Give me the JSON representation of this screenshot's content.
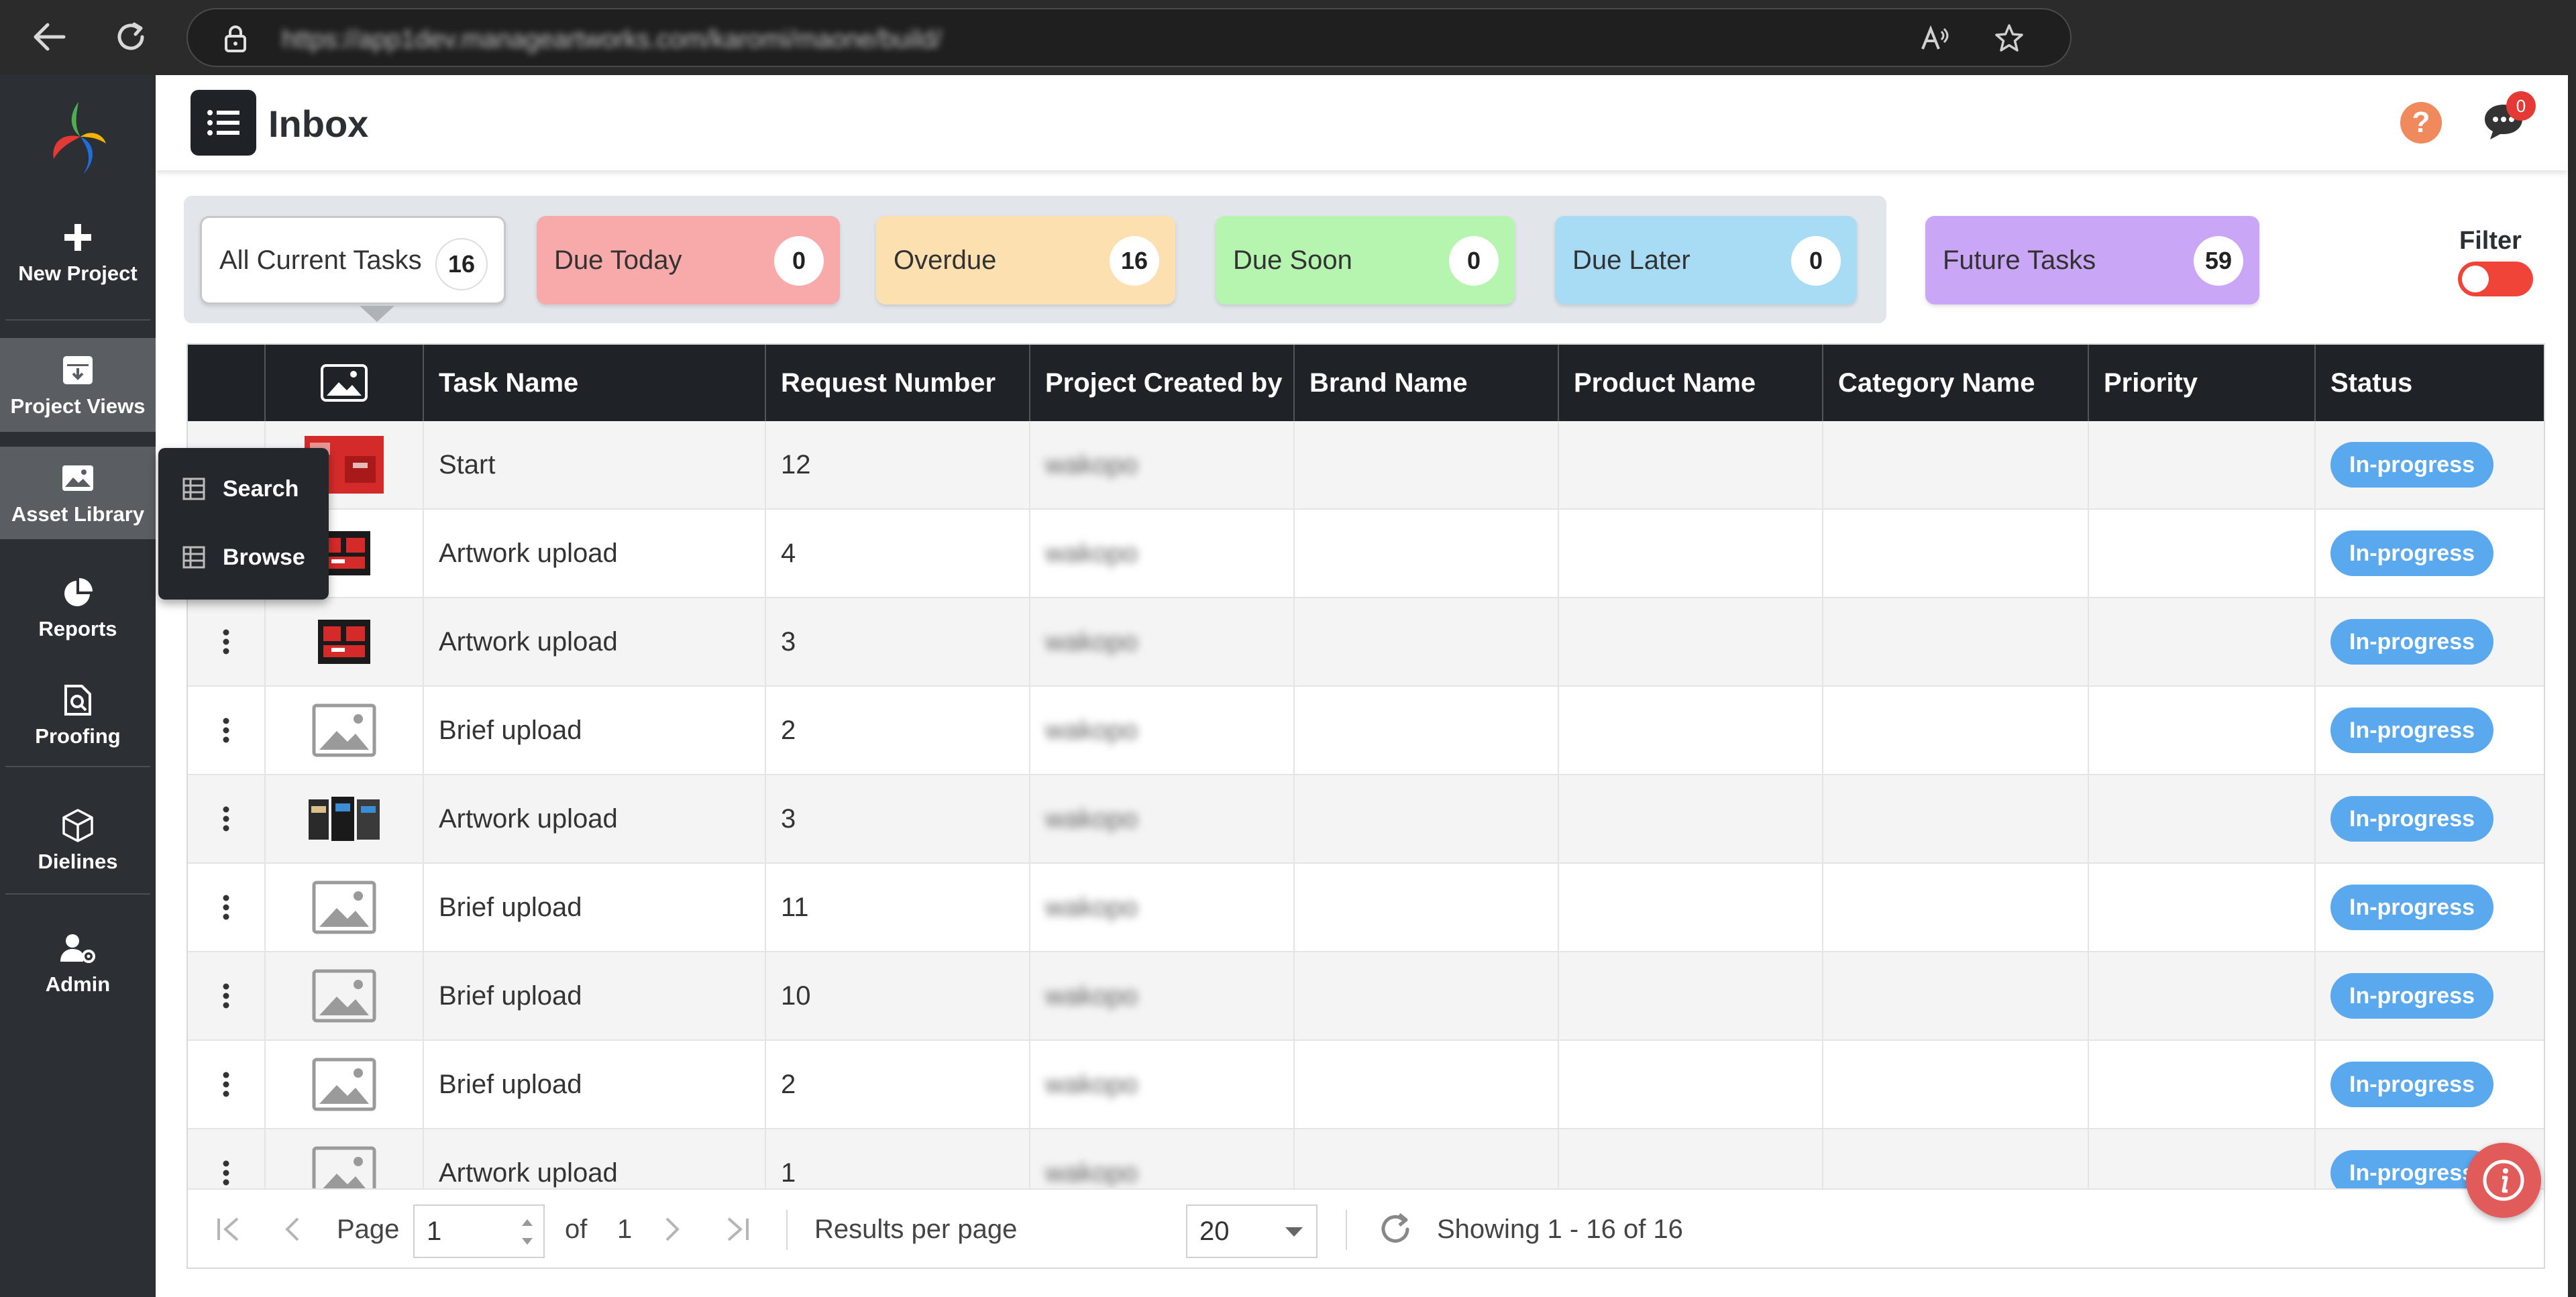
{
  "browser": {
    "url": "https://app1dev.manageartworks.com/karomi/maone/build/"
  },
  "sidebar": {
    "items": [
      {
        "label": "New Project",
        "icon": "plus-icon"
      },
      {
        "label": "Project Views",
        "icon": "archive-box-icon"
      },
      {
        "label": "Asset Library",
        "icon": "image-icon"
      },
      {
        "label": "Reports",
        "icon": "pie-chart-icon"
      },
      {
        "label": "Proofing",
        "icon": "document-search-icon"
      },
      {
        "label": "Dielines",
        "icon": "cube-icon"
      },
      {
        "label": "Admin",
        "icon": "user-gear-icon"
      }
    ]
  },
  "flyout": {
    "items": [
      {
        "label": "Search",
        "icon": "table-icon"
      },
      {
        "label": "Browse",
        "icon": "table-icon"
      }
    ]
  },
  "header": {
    "title": "Inbox",
    "help_symbol": "?",
    "chat_badge": "0"
  },
  "tabs": [
    {
      "label": "All Current Tasks",
      "count": "16",
      "color": "#ffffff"
    },
    {
      "label": "Due Today",
      "count": "0",
      "color": "#f8a9a9"
    },
    {
      "label": "Overdue",
      "count": "16",
      "color": "#fde0b0"
    },
    {
      "label": "Due Soon",
      "count": "0",
      "color": "#b6f5b0"
    },
    {
      "label": "Due Later",
      "count": "0",
      "color": "#a8dcf5"
    }
  ],
  "future_tab": {
    "label": "Future Tasks",
    "count": "59",
    "color": "#c9a6f6"
  },
  "filter": {
    "label": "Filter",
    "enabled": false
  },
  "table": {
    "columns": [
      "Task Name",
      "Request Number",
      "Project Created by",
      "Brand Name",
      "Product Name",
      "Category Name",
      "Priority",
      "Status"
    ],
    "rows": [
      {
        "thumb": "red-artwork",
        "task": "Start",
        "request": "12",
        "creator": "wakopo",
        "brand": "",
        "product": "",
        "category": "",
        "priority": "",
        "status": "In-progress"
      },
      {
        "thumb": "dark-red-artwork",
        "task": "Artwork upload",
        "request": "4",
        "creator": "wakopo",
        "brand": "",
        "product": "",
        "category": "",
        "priority": "",
        "status": "In-progress"
      },
      {
        "thumb": "dark-red-artwork",
        "task": "Artwork upload",
        "request": "3",
        "creator": "wakopo",
        "brand": "",
        "product": "",
        "category": "",
        "priority": "",
        "status": "In-progress"
      },
      {
        "thumb": "placeholder",
        "task": "Brief upload",
        "request": "2",
        "creator": "wakopo",
        "brand": "",
        "product": "",
        "category": "",
        "priority": "",
        "status": "In-progress"
      },
      {
        "thumb": "packaging-artwork",
        "task": "Artwork upload",
        "request": "3",
        "creator": "wakopo",
        "brand": "",
        "product": "",
        "category": "",
        "priority": "",
        "status": "In-progress"
      },
      {
        "thumb": "placeholder",
        "task": "Brief upload",
        "request": "11",
        "creator": "wakopo",
        "brand": "",
        "product": "",
        "category": "",
        "priority": "",
        "status": "In-progress"
      },
      {
        "thumb": "placeholder",
        "task": "Brief upload",
        "request": "10",
        "creator": "wakopo",
        "brand": "",
        "product": "",
        "category": "",
        "priority": "",
        "status": "In-progress"
      },
      {
        "thumb": "placeholder",
        "task": "Brief upload",
        "request": "2",
        "creator": "wakopo",
        "brand": "",
        "product": "",
        "category": "",
        "priority": "",
        "status": "In-progress"
      },
      {
        "thumb": "placeholder",
        "task": "Artwork upload",
        "request": "1",
        "creator": "wakopo",
        "brand": "",
        "product": "",
        "category": "",
        "priority": "",
        "status": "In-progress"
      }
    ]
  },
  "pager": {
    "page_label": "Page",
    "page_value": "1",
    "of_label": "of",
    "total_pages": "1",
    "results_label": "Results per page",
    "results_value": "20",
    "showing": "Showing 1 - 16 of 16"
  }
}
